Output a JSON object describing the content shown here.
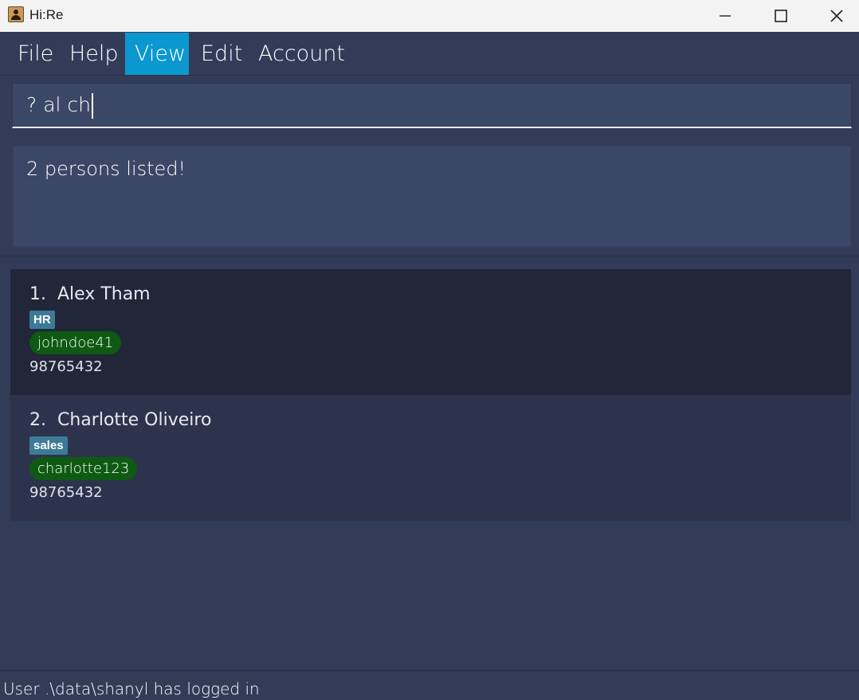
{
  "window": {
    "title": "Hi:Re"
  },
  "menu": {
    "items": [
      {
        "label": "File",
        "active": false
      },
      {
        "label": "Help",
        "active": false
      },
      {
        "label": "View",
        "active": true
      },
      {
        "label": "Edit",
        "active": false
      },
      {
        "label": "Account",
        "active": false
      }
    ]
  },
  "command": {
    "value": "? al ch"
  },
  "result": {
    "message": "2 persons listed!"
  },
  "persons": [
    {
      "index": "1.",
      "name": "Alex Tham",
      "tag": "HR",
      "username": "johndoe41",
      "phone": "98765432"
    },
    {
      "index": "2.",
      "name": "Charlotte Oliveiro",
      "tag": "sales",
      "username": "charlotte123",
      "phone": "98765432"
    }
  ],
  "status": {
    "text": "User .\\data\\shanyl has logged in"
  },
  "colors": {
    "background": "#323c58",
    "menu_active": "#0b97cf",
    "tag": "#3d7a97",
    "username_pill": "#0e5a12"
  }
}
